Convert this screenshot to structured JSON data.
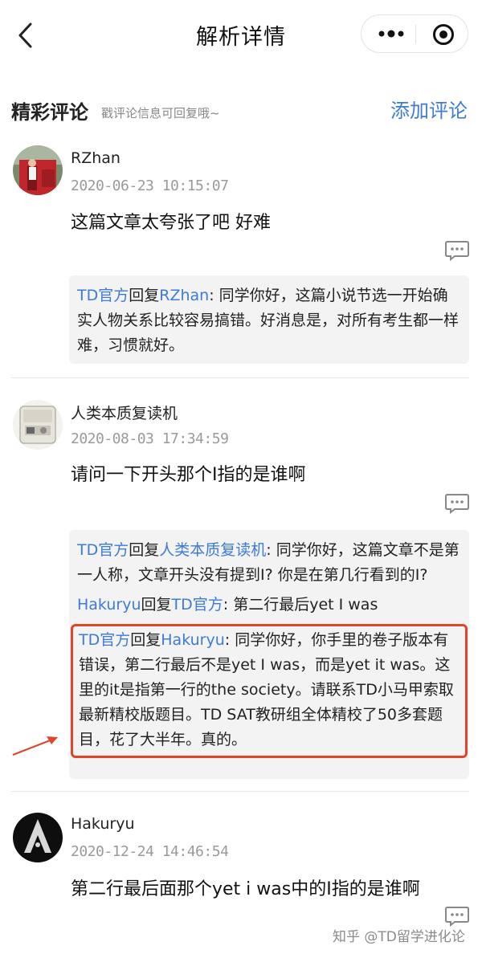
{
  "nav": {
    "title": "解析详情",
    "back_icon": "chevron-left-icon",
    "more_icon": "more-dots-icon",
    "close_icon": "target-circle-icon"
  },
  "section": {
    "title": "精彩评论",
    "hint": "戳评论信息可回复哦~",
    "add_comment": "添加评论"
  },
  "comments": [
    {
      "user": "RZhan",
      "date": "2020-06-23 10:15:07",
      "text": "这篇文章太夸张了吧 好难",
      "replies": [
        {
          "from": "TD官方",
          "verb": "回复",
          "to": "RZhan",
          "text": ": 同学你好，这篇小说节选一开始确实人物关系比较容易搞错。好消息是，对所有考生都一样难，习惯就好。"
        }
      ]
    },
    {
      "user": "人类本质复读机",
      "date": "2020-08-03 17:34:59",
      "text": "请问一下开头那个I指的是谁啊",
      "replies": [
        {
          "from": "TD官方",
          "verb": "回复",
          "to": "人类本质复读机",
          "text": ": 同学你好，这篇文章不是第一人称，文章开头没有提到I? 你是在第几行看到的I?"
        },
        {
          "from": "Hakuryu",
          "verb": "回复",
          "to": "TD官方",
          "text": ": 第二行最后yet I was"
        },
        {
          "from": "TD官方",
          "verb": "回复",
          "to": "Hakuryu",
          "text": ": 同学你好，你手里的卷子版本有错误，第二行最后不是yet I was，而是yet it was。这里的it是指第一行的the society。请联系TD小马甲索取最新精校版题目。TD SAT教研组全体精校了50多套题目，花了大半年。真的。"
        }
      ]
    },
    {
      "user": "Hakuryu",
      "date": "2020-12-24 14:46:54",
      "text": "第二行最后面那个yet i was中的I指的是谁啊"
    }
  ],
  "watermark": "知乎 @TD留学进化论",
  "colors": {
    "link": "#3d7bd6",
    "highlight_border": "#e0452c",
    "reply_bg": "#f3f3f3"
  }
}
